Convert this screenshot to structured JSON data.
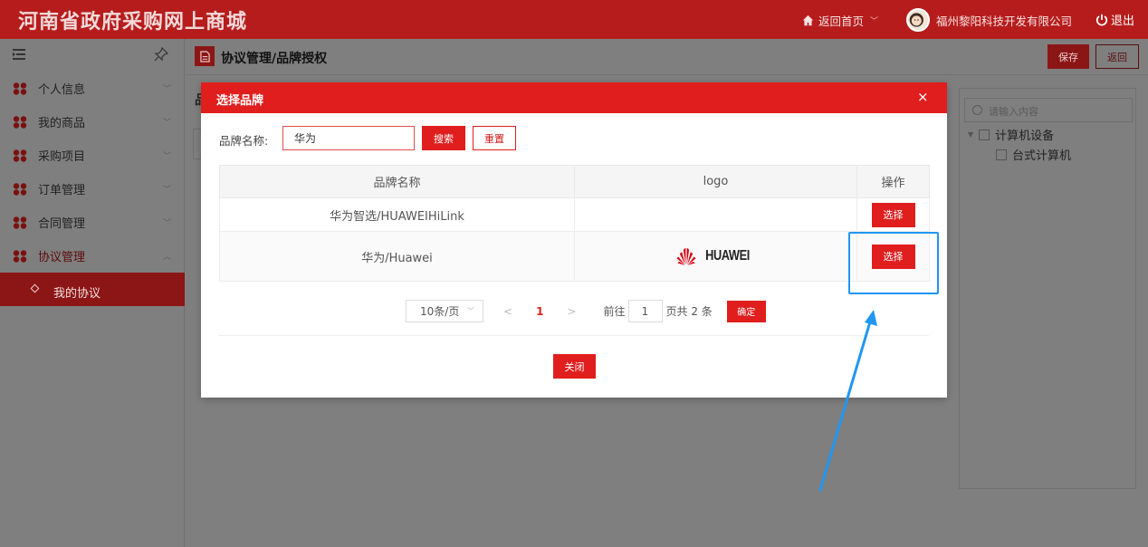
{
  "header": {
    "site_title": "河南省政府采购网上商城",
    "home_label": "返回首页",
    "company": "福州黎阳科技开发有限公司",
    "logout": "退出"
  },
  "sidebar": {
    "items": [
      {
        "label": "个人信息",
        "expanded": false
      },
      {
        "label": "我的商品",
        "expanded": false
      },
      {
        "label": "采购项目",
        "expanded": false
      },
      {
        "label": "订单管理",
        "expanded": false
      },
      {
        "label": "合同管理",
        "expanded": false
      },
      {
        "label": "协议管理",
        "expanded": true
      }
    ],
    "sub_item": "我的协议"
  },
  "breadcrumb": {
    "text": "协议管理/品牌授权",
    "save_label": "保存",
    "back_label": "返回"
  },
  "right_panel": {
    "search_placeholder": "请输入内容",
    "tree": [
      {
        "label": "计算机设备",
        "level": 0
      },
      {
        "label": "台式计算机",
        "level": 1
      }
    ]
  },
  "modal": {
    "title": "选择品牌",
    "close_icon": "×",
    "search_label": "品牌名称:",
    "search_value": "华为",
    "search_button": "搜索",
    "reset_button": "重置",
    "columns": [
      "品牌名称",
      "logo",
      "操作"
    ],
    "rows": [
      {
        "name": "华为智选/HUAWEIHiLink",
        "logo": "",
        "action": "选择"
      },
      {
        "name": "华为/Huawei",
        "logo": "HUAWEI",
        "action": "选择"
      }
    ],
    "pagination": {
      "page_size": "10条/页",
      "prev": "<",
      "current_page": "1",
      "next": ">",
      "goto_label": "前往",
      "goto_value": "1",
      "total_label": "页共 2 条",
      "confirm": "确定"
    },
    "close_button": "关闭"
  },
  "colors": {
    "brand_red": "#e01e1e",
    "header_red": "#b71c1c",
    "annotation_blue": "#2196f3"
  }
}
